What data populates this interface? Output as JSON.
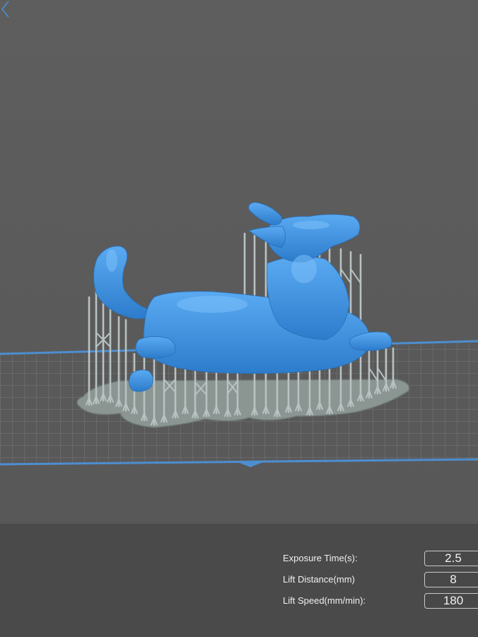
{
  "viewport": {
    "model": "corgi-model",
    "collapse_icon": "chevron-left-icon"
  },
  "colors": {
    "model": "#3d8fe0",
    "supports": "#b9c2c2",
    "raft": "#8b9693",
    "platform_edge": "#4d8ed0",
    "grid_line": "#6b6b6b",
    "viewport_bg": "#5d5d5d",
    "panel_bg": "#4a4a4a"
  },
  "settings": {
    "exposure_time": {
      "label": "Exposure Time(s):",
      "value": "2.5"
    },
    "lift_distance": {
      "label": "Lift Distance(mm)",
      "value": "8"
    },
    "lift_speed": {
      "label": "Lift Speed(mm/min):",
      "value": "180"
    }
  }
}
